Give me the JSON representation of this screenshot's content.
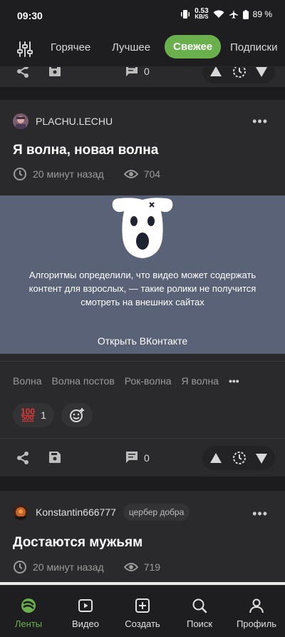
{
  "status": {
    "time": "09:30",
    "speed_value": "0.53",
    "speed_unit": "KB/S",
    "battery": "89 %"
  },
  "nav": {
    "tabs": [
      "Горячее",
      "Лучшее",
      "Свежее",
      "Подписки"
    ],
    "active": "Свежее"
  },
  "prev_post": {
    "comments": "0"
  },
  "post1": {
    "author": "PLACHU.LECHU",
    "title": "Я волна, новая волна",
    "time": "20 минут назад",
    "views": "704",
    "video_notice": "Алгоритмы определили, что видео может содержать контент для взрослых, — такие ролики не получится смотреть на внешних сайтах",
    "video_link": "Открыть ВКонтакте",
    "tags": [
      "Волна",
      "Волна постов",
      "Рок-волна",
      "Я волна"
    ],
    "reaction_emoji": [
      "100",
      "500"
    ],
    "reaction_count": "1",
    "comments": "0"
  },
  "post2": {
    "author": "Konstantin666777",
    "badge": "цербер добра",
    "title": "Достаются мужьям",
    "time": "20 минут назад",
    "views": "719"
  },
  "bottom_nav": [
    "Ленты",
    "Видео",
    "Создать",
    "Поиск",
    "Профиль"
  ],
  "colors": {
    "accent": "#6ab04c",
    "background": "#1c1c1e",
    "card": "#2a2a2c",
    "video_overlay": "#5a6278"
  }
}
